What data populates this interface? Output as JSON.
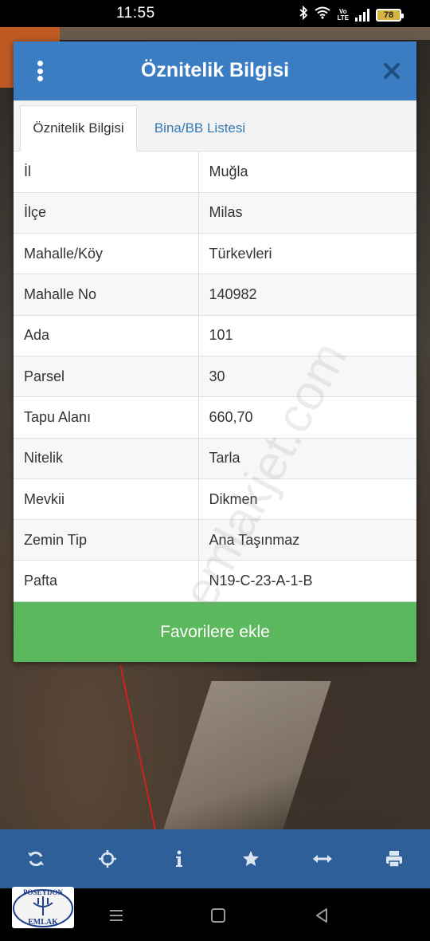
{
  "status_bar": {
    "time": "11:55",
    "battery": "78"
  },
  "dialog": {
    "title": "Öznitelik Bilgisi",
    "tabs": [
      {
        "label": "Öznitelik Bilgisi",
        "active": true
      },
      {
        "label": "Bina/BB Listesi",
        "active": false
      }
    ],
    "rows": [
      {
        "key": "İl",
        "value": "Muğla"
      },
      {
        "key": "İlçe",
        "value": "Milas"
      },
      {
        "key": "Mahalle/Köy",
        "value": "Türkevleri"
      },
      {
        "key": "Mahalle No",
        "value": "140982"
      },
      {
        "key": "Ada",
        "value": "101"
      },
      {
        "key": "Parsel",
        "value": "30"
      },
      {
        "key": "Tapu Alanı",
        "value": "660,70"
      },
      {
        "key": "Nitelik",
        "value": "Tarla"
      },
      {
        "key": "Mevkii",
        "value": "Dikmen"
      },
      {
        "key": "Zemin Tip",
        "value": "Ana Taşınmaz"
      },
      {
        "key": "Pafta",
        "value": "N19-C-23-A-1-B"
      }
    ],
    "favorite_button": "Favorilere ekle"
  },
  "watermark": "emlakjet.com",
  "logo": {
    "top_text": "POSEYDON",
    "bottom_text": "EMLAK"
  },
  "toolbar": {
    "icons": [
      "refresh-icon",
      "crosshair-icon",
      "info-icon",
      "star-icon",
      "measure-icon",
      "print-icon"
    ]
  },
  "colors": {
    "header": "#3b7dc3",
    "toolbar": "#2f5f99",
    "favorite": "#5cb85c",
    "tab_link": "#337ab7"
  }
}
